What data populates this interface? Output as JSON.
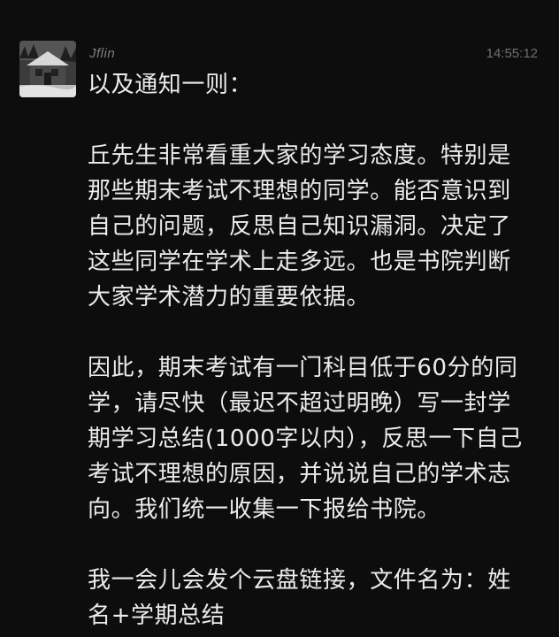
{
  "message": {
    "sender": "Jflin",
    "timestamp": "14:55:12",
    "avatar": "cabin-in-snow-photo",
    "paragraphs": [
      [
        "以及通知一则："
      ],
      [
        "丘先生非常看重大家的学习态度。特别是",
        "那些期末考试不理想的同学。能否意识到",
        "自己的问题，反思自己知识漏洞。决定了",
        "这些同学在学术上走多远。也是书院判断",
        "大家学术潜力的重要依据。"
      ],
      [
        "因此，期末考试有一门科目低于60分的同",
        "学，请尽快（最迟不超过明晚）写一封学",
        "期学习总结(1000字以内），反思一下自己",
        "考试不理想的原因，并说说自己的学术志",
        "向。我们统一收集一下报给书院。"
      ],
      [
        "我一会儿会发个云盘链接，文件名为：姓",
        "名+学期总结"
      ]
    ]
  }
}
